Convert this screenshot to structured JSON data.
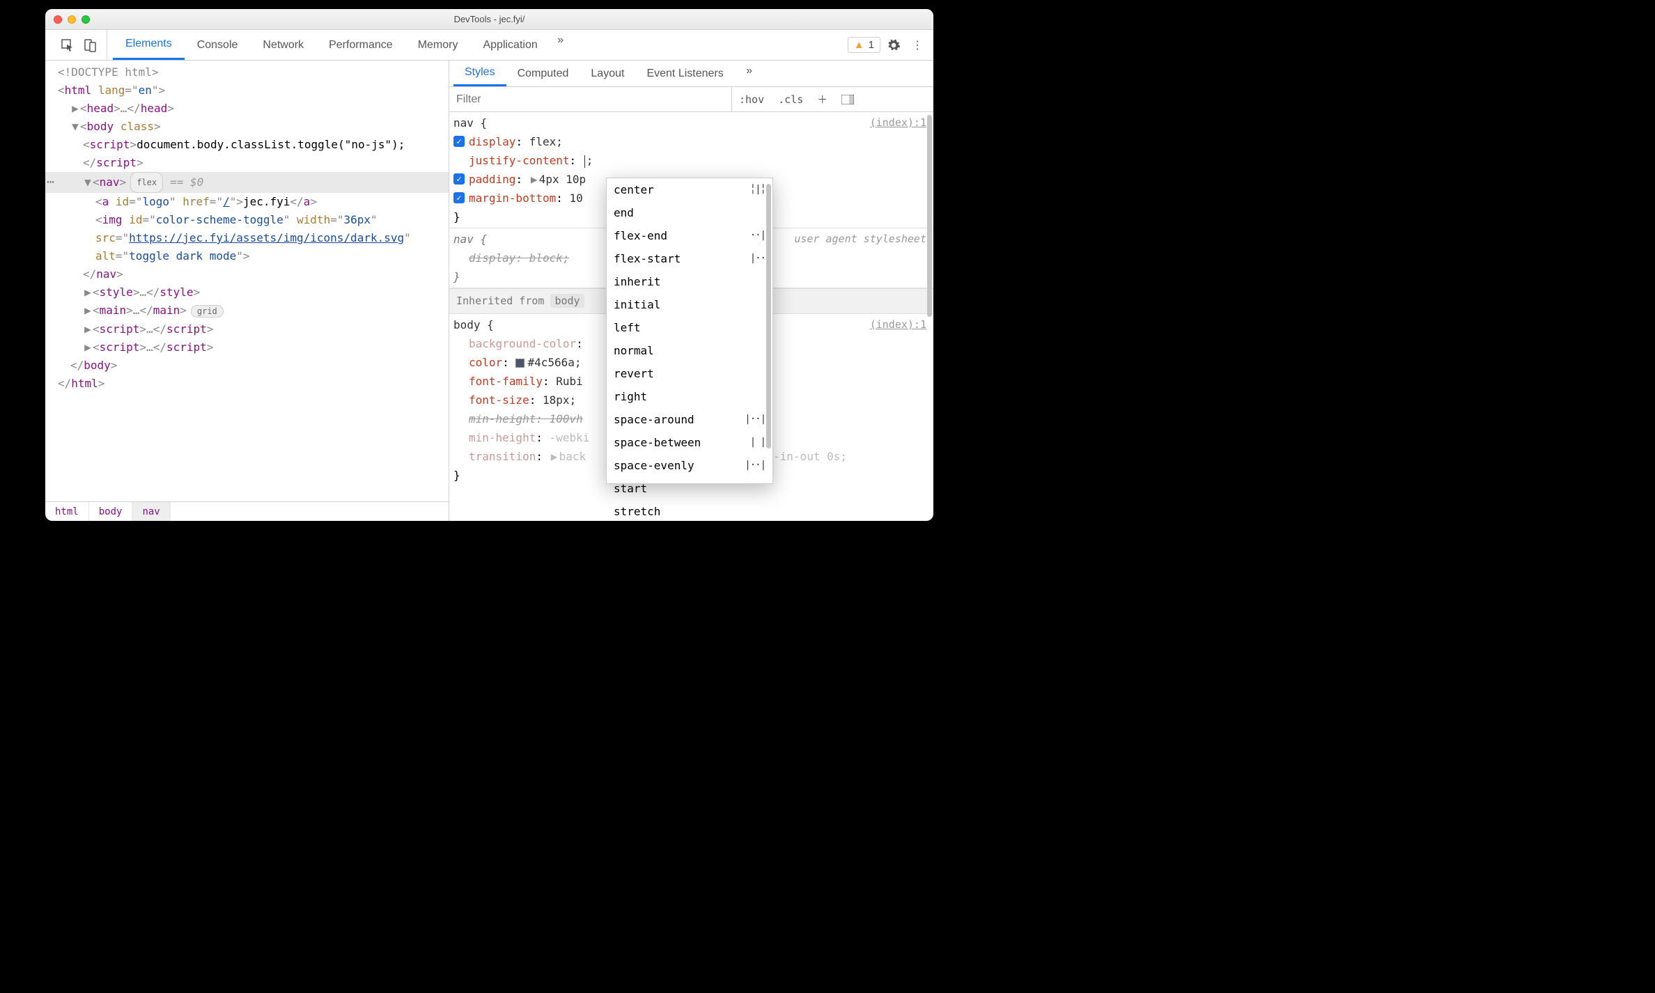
{
  "window": {
    "title": "DevTools - jec.fyi/"
  },
  "toolbar": {
    "tabs": [
      "Elements",
      "Console",
      "Network",
      "Performance",
      "Memory",
      "Application"
    ],
    "active_tab": "Elements",
    "warning_count": "1"
  },
  "dom": {
    "doctype": "<!DOCTYPE html>",
    "html_open": "<html lang=\"en\">",
    "head": "<head>…</head>",
    "body_open": "<body class>",
    "script1a": "<script>",
    "script1b": "document.body.classList.toggle(\"no-js\");",
    "script1c": "</script>",
    "nav_open": "<nav>",
    "nav_pill": "flex",
    "nav_eq": "== $0",
    "a_line_pre": "<a id=\"logo\" href=\"",
    "a_href": "/",
    "a_line_mid": "\">",
    "a_text": "jec.fyi",
    "a_close": "</a>",
    "img_pre": "<img id=\"color-scheme-toggle\" width=\"36px\" src=\"",
    "img_src": "https://jec.fyi/assets/img/icons/dark.svg",
    "img_post1": "\" alt=\"toggle dark mode\">",
    "nav_close": "</nav>",
    "style_line": "<style>…</style>",
    "main_line": "<main>…</main>",
    "main_pill": "grid",
    "scriptA": "<script>…</script>",
    "scriptB": "<script>…</script>",
    "body_close": "</body>",
    "html_close": "</html>"
  },
  "breadcrumbs": [
    "html",
    "body",
    "nav"
  ],
  "sidebar": {
    "tabs": [
      "Styles",
      "Computed",
      "Layout",
      "Event Listeners"
    ],
    "active": "Styles",
    "filter_placeholder": "Filter",
    "buttons": {
      "hov": ":hov",
      "cls": ".cls"
    }
  },
  "rules": {
    "nav1": {
      "selector": "nav {",
      "source": "(index):1",
      "display": {
        "name": "display",
        "value": "flex;"
      },
      "jc": {
        "name": "justify-content",
        "value": ";"
      },
      "padding": {
        "name": "padding",
        "value": "4px 10p"
      },
      "mb": {
        "name": "margin-bottom",
        "value": "10"
      },
      "close": "}"
    },
    "nav2": {
      "selector": "nav {",
      "source": "user agent stylesheet",
      "display": {
        "name": "display",
        "value": "block;"
      },
      "close": "}"
    },
    "inherited_label": "Inherited from",
    "inherited_from": "body",
    "body": {
      "selector": "body {",
      "source": "(index):1",
      "bg": {
        "name": "background-color",
        "suffix": ""
      },
      "color": {
        "name": "color",
        "value": "#4c566a;"
      },
      "ff": {
        "name": "font-family",
        "value": "Rubi"
      },
      "fs": {
        "name": "font-size",
        "value": "18px;"
      },
      "mh1": {
        "name": "min-height",
        "value": "100vh"
      },
      "mh2": {
        "name": "min-height",
        "value": "-webki"
      },
      "tr": {
        "name": "transition",
        "pre": "back",
        "post": "ase-in-out 0s;"
      },
      "close": "}"
    }
  },
  "suggestions": [
    "center",
    "end",
    "flex-end",
    "flex-start",
    "inherit",
    "initial",
    "left",
    "normal",
    "revert",
    "right",
    "space-around",
    "space-between",
    "space-evenly",
    "start",
    "stretch"
  ],
  "suggestion_glyphs": {
    "center": "╎|╎",
    "flex-end": "··|",
    "flex-start": "|··",
    "space-around": "|··|",
    "space-between": "|  |",
    "space-evenly": "|··|"
  }
}
